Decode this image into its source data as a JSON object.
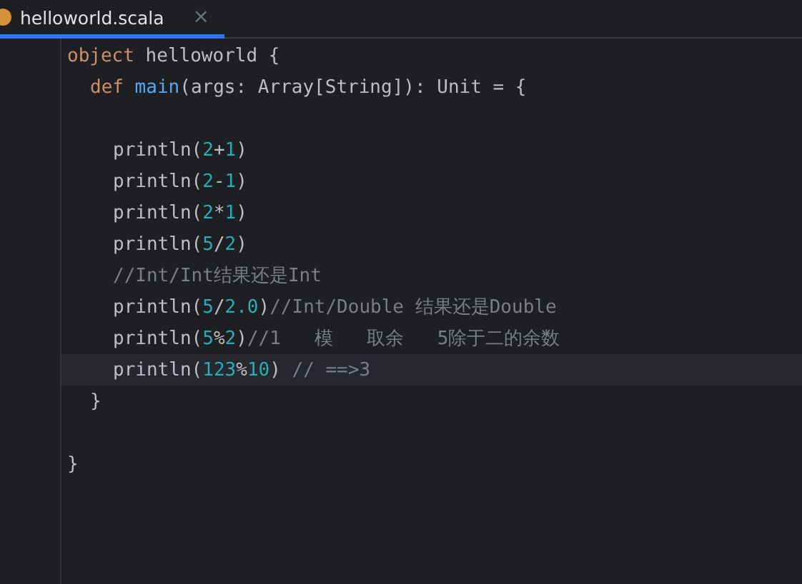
{
  "tab": {
    "title": "helloworld.scala",
    "selected": true,
    "close": "×"
  },
  "code": [
    {
      "kind": "code",
      "current": false,
      "tokens": [
        {
          "kind": "keyword",
          "text": "object"
        },
        {
          "kind": "plain",
          "text": " helloworld {"
        }
      ],
      "children": [
        {
          "kind": "code",
          "current": false,
          "tokens": [
            {
              "kind": "keyword",
              "text": "def"
            },
            {
              "kind": "fn",
              "text": " main"
            },
            {
              "kind": "plain",
              "text": "(args: Array[String]): Unit = {"
            }
          ],
          "children": [
            {
              "kind": "blank",
              "current": false
            },
            {
              "kind": "code",
              "current": false,
              "tokens": [
                {
                  "kind": "plain",
                  "text": "println("
                },
                {
                  "kind": "number",
                  "text": "2"
                },
                {
                  "kind": "plain",
                  "text": "+"
                },
                {
                  "kind": "number",
                  "text": "1"
                },
                {
                  "kind": "plain",
                  "text": ")"
                }
              ]
            },
            {
              "kind": "code",
              "current": false,
              "tokens": [
                {
                  "kind": "plain",
                  "text": "println("
                },
                {
                  "kind": "number",
                  "text": "2"
                },
                {
                  "kind": "plain",
                  "text": "-"
                },
                {
                  "kind": "number",
                  "text": "1"
                },
                {
                  "kind": "plain",
                  "text": ")"
                }
              ]
            },
            {
              "kind": "code",
              "current": false,
              "tokens": [
                {
                  "kind": "plain",
                  "text": "println("
                },
                {
                  "kind": "number",
                  "text": "2"
                },
                {
                  "kind": "plain",
                  "text": "*"
                },
                {
                  "kind": "number",
                  "text": "1"
                },
                {
                  "kind": "plain",
                  "text": ")"
                }
              ]
            },
            {
              "kind": "code",
              "current": false,
              "tokens": [
                {
                  "kind": "plain",
                  "text": "println("
                },
                {
                  "kind": "number",
                  "text": "5"
                },
                {
                  "kind": "plain",
                  "text": "/"
                },
                {
                  "kind": "number",
                  "text": "2"
                },
                {
                  "kind": "plain",
                  "text": ")"
                }
              ]
            },
            {
              "kind": "code",
              "current": false,
              "tokens": [
                {
                  "kind": "comment",
                  "text": "//Int/Int结果还是Int"
                }
              ]
            },
            {
              "kind": "code",
              "current": false,
              "tokens": [
                {
                  "kind": "plain",
                  "text": "println("
                },
                {
                  "kind": "number",
                  "text": "5"
                },
                {
                  "kind": "plain",
                  "text": "/"
                },
                {
                  "kind": "number",
                  "text": "2.0"
                },
                {
                  "kind": "plain",
                  "text": ")"
                },
                {
                  "kind": "comment",
                  "text": "//Int/Double 结果还是Double"
                }
              ]
            },
            {
              "kind": "code",
              "current": false,
              "tokens": [
                {
                  "kind": "plain",
                  "text": "println("
                },
                {
                  "kind": "number",
                  "text": "5"
                },
                {
                  "kind": "plain",
                  "text": "%"
                },
                {
                  "kind": "number",
                  "text": "2"
                },
                {
                  "kind": "plain",
                  "text": ")"
                },
                {
                  "kind": "comment",
                  "text": "//1   模   取余   5除于二的余数"
                }
              ]
            },
            {
              "kind": "code",
              "current": true,
              "tokens": [
                {
                  "kind": "plain",
                  "text": "println("
                },
                {
                  "kind": "number",
                  "text": "123"
                },
                {
                  "kind": "plain",
                  "text": "%"
                },
                {
                  "kind": "number",
                  "text": "10"
                },
                {
                  "kind": "plain",
                  "text": ") "
                },
                {
                  "kind": "comment",
                  "text": "// ==>3"
                }
              ]
            }
          ]
        },
        {
          "kind": "code",
          "current": false,
          "tokens": [
            {
              "kind": "plain",
              "text": "}"
            }
          ]
        },
        {
          "kind": "blank",
          "current": false
        }
      ]
    },
    {
      "kind": "code",
      "current": false,
      "tokens": [
        {
          "kind": "plain",
          "text": "}"
        }
      ]
    }
  ]
}
